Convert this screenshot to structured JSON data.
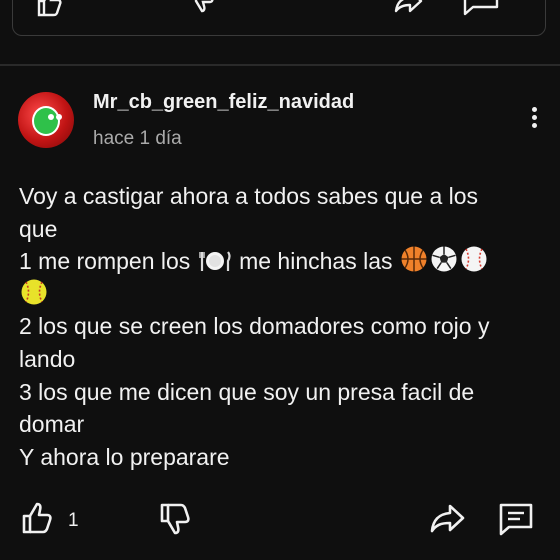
{
  "comment": {
    "username": "Mr_cb_green_feliz_navidad",
    "timestamp": "hace 1 día",
    "lines": [
      "Voy a castigar ahora a todos sabes que a los",
      "que",
      "1 me rompen los",
      "me hinchas las",
      "2 los que se creen los domadores como rojo y",
      "lando",
      "3 los que me dicen que soy un presa facil de",
      "domar",
      "Y ahora lo preparare"
    ],
    "emojis": [
      "plate-emoji",
      "basketball-emoji",
      "soccer-ball-emoji",
      "baseball-emoji",
      "softball-emoji"
    ],
    "like_count": "1"
  },
  "icons": {
    "like": "thumb-up-icon",
    "dislike": "thumb-down-icon",
    "share": "share-icon",
    "reply": "reply-icon",
    "more": "more-vert-icon"
  }
}
